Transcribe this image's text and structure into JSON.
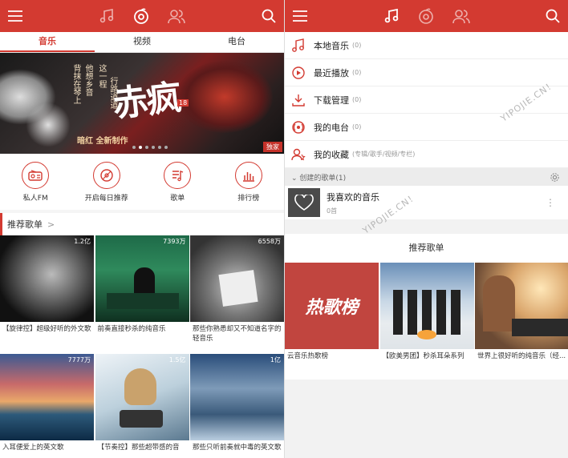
{
  "left": {
    "tabs": [
      "音乐",
      "视频",
      "电台"
    ],
    "banner": {
      "headline": "赤疯",
      "badge": "18",
      "col1": "背抹在琴上",
      "col2": "他想乡音",
      "col3": "这一程",
      "col4": "行路道道",
      "subtitle": "暗红 全新制作",
      "tag": "独家"
    },
    "quick": [
      "私人FM",
      "开启每日推荐",
      "歌单",
      "排行榜"
    ],
    "section_title": "推荐歌单",
    "section_arrow": ">",
    "playlists": [
      {
        "count": "1.2亿",
        "caption": "【旋律控】超级好听的外文歌"
      },
      {
        "count": "7393万",
        "caption": "前奏直接秒杀的纯音乐"
      },
      {
        "count": "6558万",
        "caption": "那些你熟悉却又不知道名字的轻音乐"
      },
      {
        "count": "7777万",
        "caption": "入耳便爱上的英文歌"
      },
      {
        "count": "1.5亿",
        "caption": "【节奏控】那些超带感的音"
      },
      {
        "count": "1亿",
        "caption": "那些只听前奏就中毒的英文歌"
      }
    ]
  },
  "right": {
    "menu": [
      {
        "label": "本地音乐",
        "count": "(0)",
        "icon": "music-note-icon"
      },
      {
        "label": "最近播放",
        "count": "(0)",
        "icon": "recent-play-icon"
      },
      {
        "label": "下载管理",
        "count": "(0)",
        "icon": "download-icon"
      },
      {
        "label": "我的电台",
        "count": "(0)",
        "icon": "radio-icon"
      },
      {
        "label": "我的收藏",
        "count": "(专辑/歌手/视频/专栏)",
        "icon": "favorites-icon"
      }
    ],
    "created_label": "创建的歌单(1)",
    "fav_playlist": {
      "title": "我喜欢的音乐",
      "count": "0首"
    },
    "rec_title": "推荐歌单",
    "rec_hot_text": "热歌榜",
    "rec_items": [
      {
        "caption": "云音乐热歌榜"
      },
      {
        "caption": "【欧美男团】秒杀耳朵系列"
      },
      {
        "caption": "世界上很好听的纯音乐（经..."
      }
    ]
  },
  "watermark": "YIPOJIE.CN！",
  "colors": {
    "brand": "#d33a31"
  }
}
